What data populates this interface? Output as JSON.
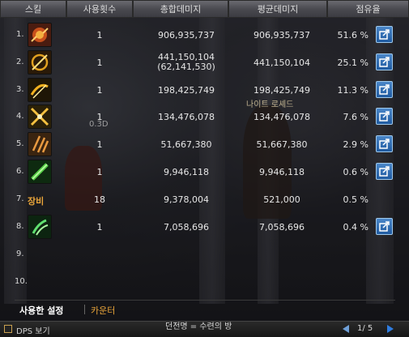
{
  "header": {
    "skill": "스킬",
    "uses": "사용횟수",
    "total": "총합데미지",
    "avg": "평균데미지",
    "share": "점유율"
  },
  "rows": [
    {
      "num": "1.",
      "icon": "flame-orb-skill-icon",
      "count": "1",
      "total": "906,935,737",
      "avg": "906,935,737",
      "pct": "51.6 %"
    },
    {
      "num": "2.",
      "icon": "spiral-slash-skill-icon",
      "count": "1",
      "total": "441,150,104",
      "total_sub": "(62,141,530)",
      "avg": "441,150,104",
      "pct": "25.1 %"
    },
    {
      "num": "3.",
      "icon": "dash-strike-skill-icon",
      "count": "1",
      "total": "198,425,749",
      "avg": "198,425,749",
      "pct": "11.3 %"
    },
    {
      "num": "4.",
      "icon": "cross-blade-skill-icon",
      "count": "1",
      "total": "134,476,078",
      "avg": "134,476,078",
      "pct": "7.6 %"
    },
    {
      "num": "5.",
      "icon": "triple-slash-skill-icon",
      "count": "1",
      "total": "51,667,380",
      "avg": "51,667,380",
      "pct": "2.9 %"
    },
    {
      "num": "6.",
      "icon": "green-blade-skill-icon",
      "count": "1",
      "total": "9,946,118",
      "avg": "9,946,118",
      "pct": "0.6 %"
    },
    {
      "num": "7.",
      "label": "장비",
      "count": "18",
      "total": "9,378,004",
      "avg": "521,000",
      "pct": "0.5 %"
    },
    {
      "num": "8.",
      "icon": "green-claw-skill-icon",
      "count": "1",
      "total": "7,058,696",
      "avg": "7,058,696",
      "pct": "0.4 %"
    },
    {
      "num": "9."
    },
    {
      "num": "10."
    }
  ],
  "tabs": {
    "settings": "사용한 설정",
    "counter": "카운터"
  },
  "bottom": {
    "dps_label": "DPS 보기",
    "dungeon": "던전명 = 수련의 방",
    "page": "1/ 5"
  },
  "overlay_text": {
    "name_tag": "나이트 로셰드",
    "dmg_tag": "0.3D"
  },
  "colors": {
    "equip_label": "#e8a43a",
    "counter_tab": "#e8a43a",
    "share_button": "#2f6fb8"
  }
}
